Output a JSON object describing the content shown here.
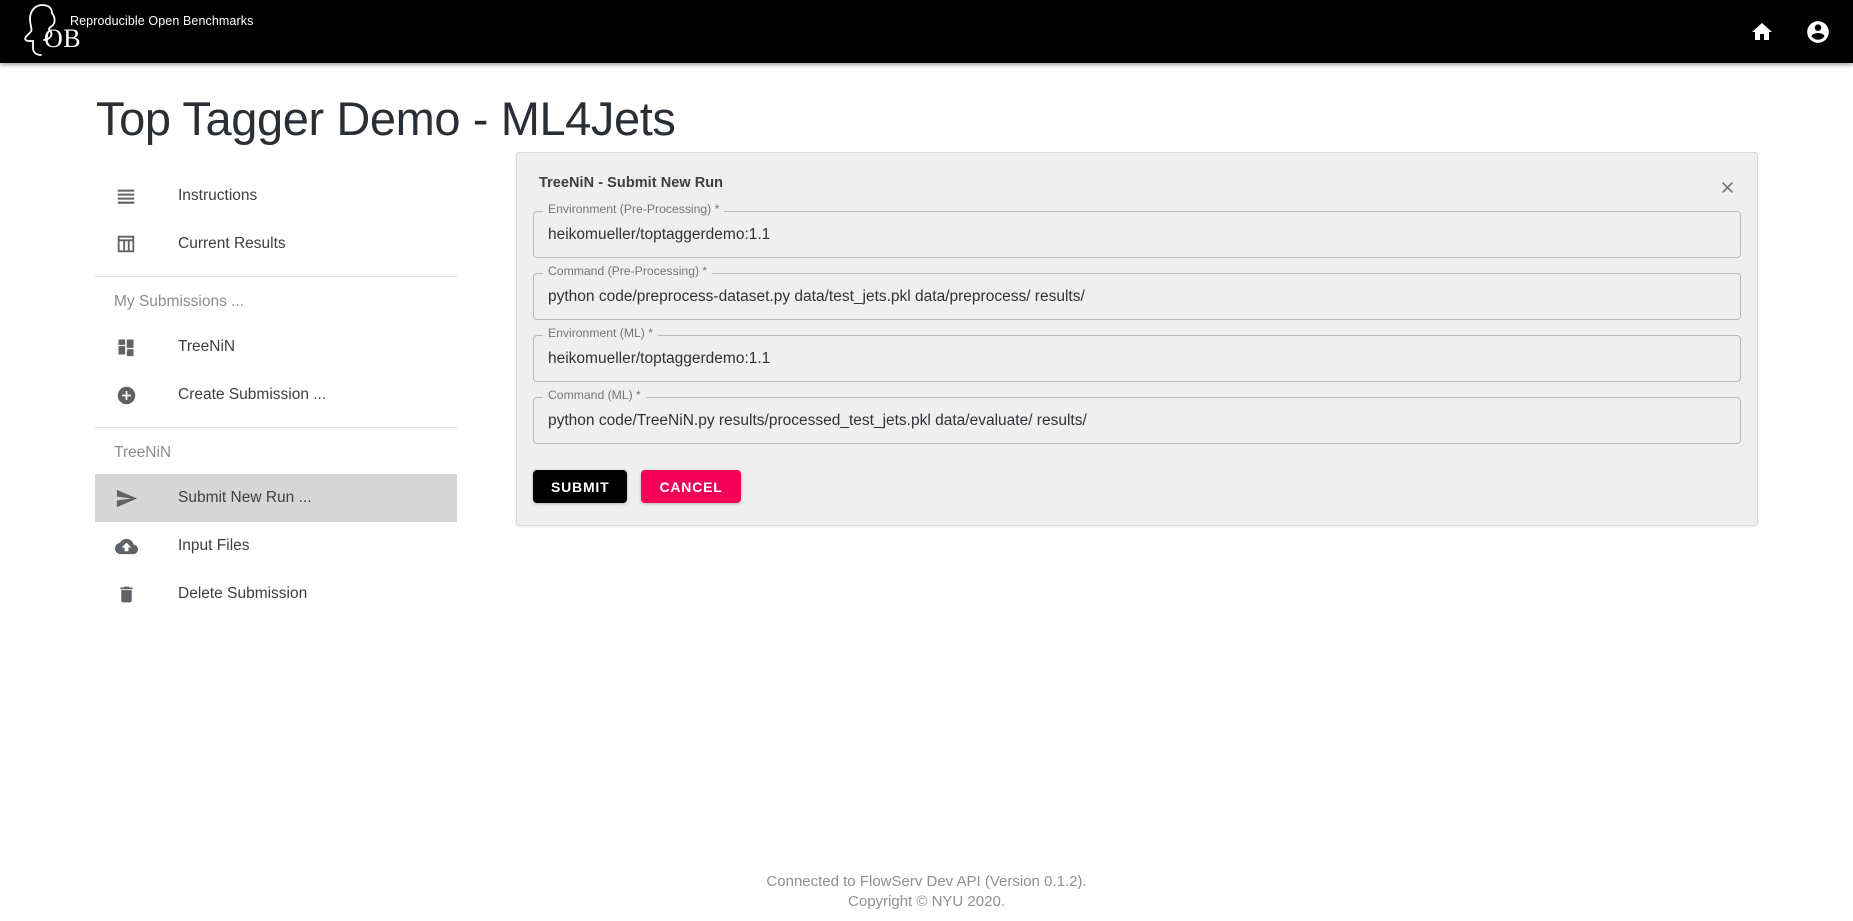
{
  "appbar": {
    "brand_text": "Reproducible Open Benchmarks",
    "brand_mark": "OB",
    "logo_icon": "head-profile-icon",
    "home_icon": "home-icon",
    "account_icon": "account-circle-icon",
    "background": "#000000"
  },
  "page": {
    "title": "Top Tagger Demo - ML4Jets"
  },
  "sidebar": {
    "items": [
      {
        "label": "Instructions",
        "icon": "list-icon",
        "selected": false
      },
      {
        "label": "Current Results",
        "icon": "table-icon",
        "selected": false
      }
    ],
    "submissions_subheader": "My Submissions ...",
    "submission_items": [
      {
        "label": "TreeNiN",
        "icon": "dashboard-icon",
        "selected": false
      },
      {
        "label": "Create Submission ...",
        "icon": "add-circle-icon",
        "selected": false
      }
    ],
    "active_subheader": "TreeNiN",
    "active_items": [
      {
        "label": "Submit New Run ...",
        "icon": "send-icon",
        "selected": true
      },
      {
        "label": "Input Files",
        "icon": "cloud-upload-icon",
        "selected": false
      },
      {
        "label": "Delete Submission",
        "icon": "delete-trash-icon",
        "selected": false
      }
    ],
    "selected_background": "#d6d6d6"
  },
  "panel": {
    "title": "TreeNiN - Submit New Run",
    "close_icon": "close-x-icon",
    "fields": [
      {
        "label": "Environment (Pre-Processing) *",
        "value": "heikomueller/toptaggerdemo:1.1",
        "placeholder": ""
      },
      {
        "label": "Command (Pre-Processing) *",
        "value": "python code/preprocess-dataset.py data/test_jets.pkl data/preprocess/ results/",
        "placeholder": ""
      },
      {
        "label": "Environment (ML) *",
        "value": "heikomueller/toptaggerdemo:1.1",
        "placeholder": ""
      },
      {
        "label": "Command (ML) *",
        "value": "python code/TreeNiN.py results/processed_test_jets.pkl data/evaluate/ results/",
        "placeholder": ""
      }
    ],
    "submit_label": "SUBMIT",
    "cancel_label": "CANCEL",
    "submit_color": "#000000",
    "cancel_color": "#f50057"
  },
  "footer": {
    "line1": "Connected to FlowServ Dev API (Version 0.1.2).",
    "line2": "Copyright © NYU 2020."
  }
}
